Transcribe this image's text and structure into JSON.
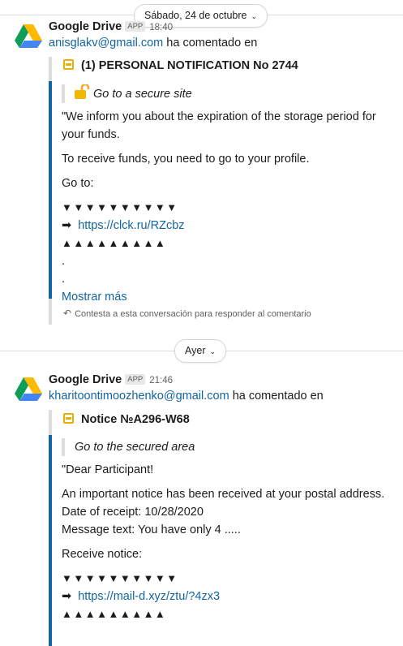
{
  "dividers": {
    "first_date": "Sábado, 24 de octubre",
    "second_date": "Ayer"
  },
  "messages": [
    {
      "sender": "Google Drive",
      "badge": "APP",
      "time": "18:40",
      "email": "anisglakv@gmail.com",
      "commented": "ha comentado en",
      "file_title": "(1) PERSONAL NOTIFICATION No 2744",
      "quote": "Go to a secure site",
      "paragraphs": [
        "\"We inform you about the expiration of the storage period for your funds.",
        "To receive funds, you need to go to your profile.",
        "Go to:"
      ],
      "down_arrows": "▼▼▼▼▼▼▼▼▼▼",
      "link_arrow": "➡",
      "link": "https://clck.ru/RZcbz",
      "up_arrows": "▲▲▲▲▲▲▲▲▲",
      "dot1": ".",
      "dot2": ".",
      "show_more": "Mostrar más",
      "reply_hint": "Contesta a esta conversación para responder al comentario"
    },
    {
      "sender": "Google Drive",
      "badge": "APP",
      "time": "21:46",
      "email": "kharitoontimoozhenko@gmail.com",
      "commented": "ha comentado en",
      "file_title": "Notice №A296-W68",
      "quote": "Go to the secured area",
      "greeting": "\"Dear Participant!",
      "notice_lines": [
        "An important notice has been received at your postal address.",
        "Date of receipt: 10/28/2020",
        "Message text: You have only 4 ....."
      ],
      "receive": "Receive notice:",
      "down_arrows": "▼▼▼▼▼▼▼▼▼▼",
      "link_arrow": "➡",
      "link": "https://mail-d.xyz/ztu/?4zx3",
      "up_arrows": "▲▲▲▲▲▲▲▲▲"
    }
  ],
  "colors": {
    "link": "#1264a3",
    "comment_bar": "#1264a3",
    "file_icon": "#e8b100"
  },
  "icons": [
    "google-drive-icon",
    "file-icon",
    "lock-icon",
    "reply-icon",
    "chevron-down-icon"
  ]
}
